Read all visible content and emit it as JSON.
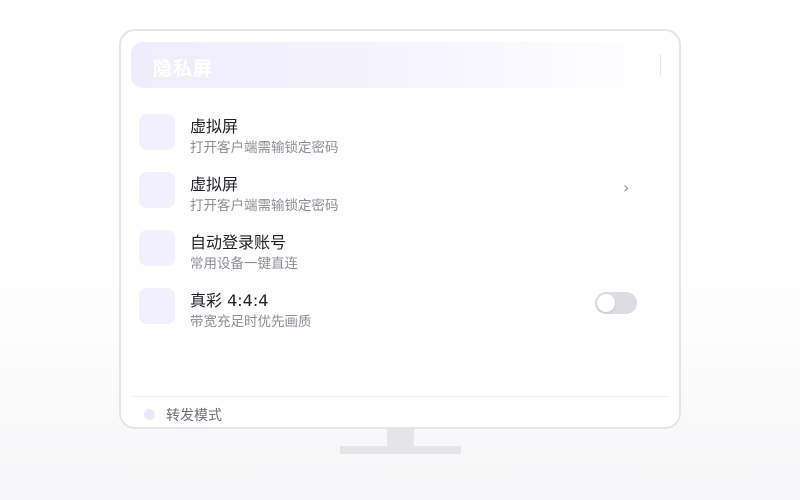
{
  "header": {
    "title": "隐私屏"
  },
  "rows": [
    {
      "title": "虚拟屏",
      "subtitle": "打开客户端需输锁定密码",
      "accessory": "none"
    },
    {
      "title": "虚拟屏",
      "subtitle": "打开客户端需输锁定密码",
      "accessory": "chevron",
      "chevron_glyph": "›"
    },
    {
      "title": "自动登录账号",
      "subtitle": "常用设备一键直连",
      "accessory": "none"
    },
    {
      "title": "真彩 4:4:4",
      "subtitle": "带宽充足时优先画质",
      "accessory": "toggle",
      "toggle_on": false
    }
  ],
  "footer": {
    "label": "转发模式"
  },
  "icons": {
    "row_icon": "app-icon-placeholder",
    "chevron": "chevron-right-icon",
    "footer_dot": "status-dot-icon"
  },
  "colors": {
    "accent_light": "#f2f0fe",
    "header_gradient_start": "#efedfd",
    "toggle_off": "#dcdce2",
    "frame": "#e4e4e9",
    "title_text": "#222228",
    "subtitle_text": "#8d8d96"
  }
}
